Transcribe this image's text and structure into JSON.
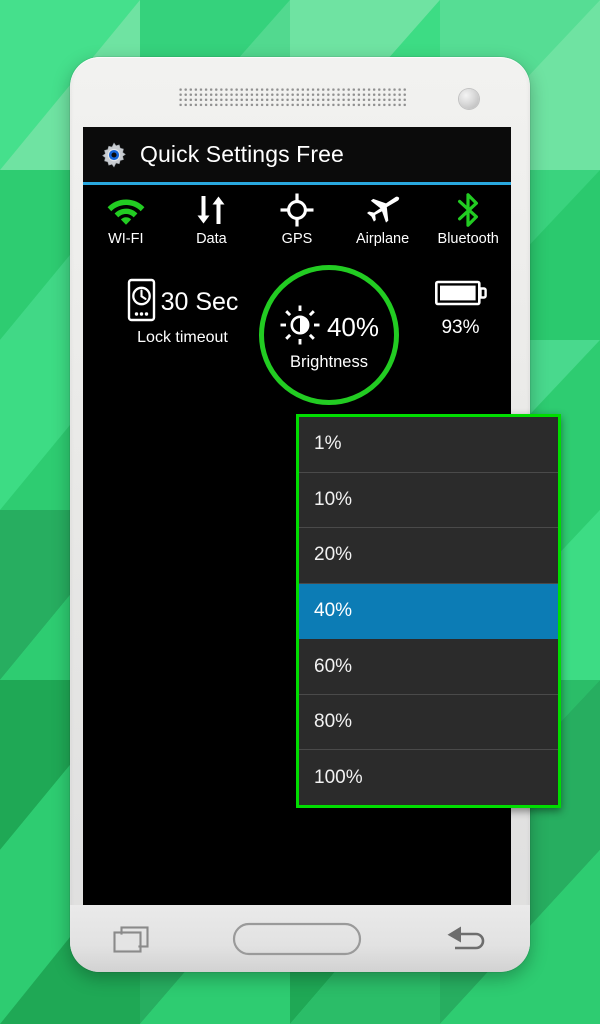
{
  "app": {
    "title": "Quick Settings Free",
    "title_icon": "gear-icon",
    "accent_green": "#00dd00",
    "accent_blue": "#29a8df",
    "selected_blue": "#0c7cb5",
    "screen_background": "#000000"
  },
  "toggles": [
    {
      "label": "WI-FI",
      "icon": "wifi-icon",
      "color": "#22cc22",
      "state": "on"
    },
    {
      "label": "Data",
      "icon": "data-sync-icon",
      "color": "#ffffff",
      "state": "on"
    },
    {
      "label": "GPS",
      "icon": "gps-icon",
      "color": "#ffffff",
      "state": "on"
    },
    {
      "label": "Airplane",
      "icon": "airplane-icon",
      "color": "#ffffff",
      "state": "on"
    },
    {
      "label": "Bluetooth",
      "icon": "bluetooth-icon",
      "color": "#22cc22",
      "state": "on"
    }
  ],
  "lock_timeout": {
    "icon": "phone-clock-icon",
    "value": "30 Sec",
    "label": "Lock timeout"
  },
  "brightness": {
    "icon": "sun-half-icon",
    "value": "40%",
    "label": "Brightness",
    "ring_color": "#22cc22"
  },
  "battery": {
    "icon": "battery-icon",
    "label": "93%"
  },
  "brightness_dropdown": {
    "border_color": "#00dd00",
    "options": [
      {
        "label": "1%",
        "selected": false
      },
      {
        "label": "10%",
        "selected": false
      },
      {
        "label": "20%",
        "selected": false
      },
      {
        "label": "40%",
        "selected": true
      },
      {
        "label": "60%",
        "selected": false
      },
      {
        "label": "80%",
        "selected": false
      },
      {
        "label": "100%",
        "selected": false
      }
    ]
  },
  "navbar": {
    "buttons": [
      {
        "name": "recents-button",
        "icon": "recents-icon"
      },
      {
        "name": "home-button",
        "icon": "home-pill-icon"
      },
      {
        "name": "back-button",
        "icon": "back-arrow-icon"
      }
    ]
  },
  "background": {
    "style": "green-triangle-tessellation",
    "colors": [
      "#3ddc84",
      "#2ecc71",
      "#27ae60",
      "#6fe3a2",
      "#1fa855"
    ]
  }
}
